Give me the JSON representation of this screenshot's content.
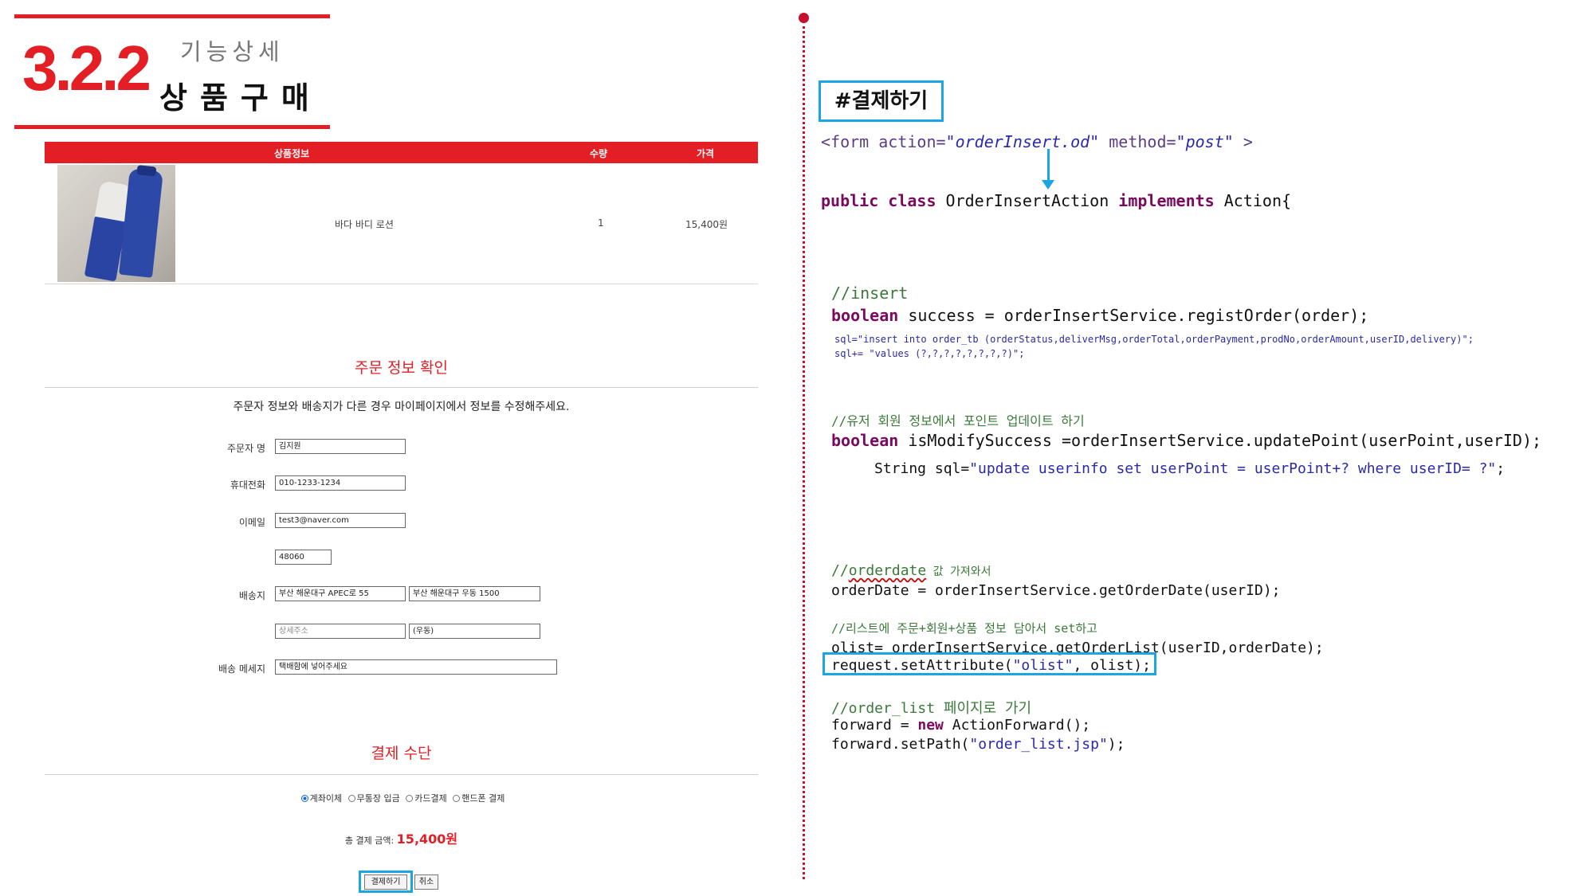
{
  "header": {
    "section_number": "3.2.2",
    "subtitle": "기능상세",
    "title": "상품구매"
  },
  "cart": {
    "columns": [
      "상품정보",
      "수량",
      "가격"
    ],
    "item": {
      "name": "바다 바디 로션",
      "qty": "1",
      "price": "15,400원"
    }
  },
  "order_info": {
    "heading": "주문 정보 확인",
    "notice": "주문자 정보와 배송지가 다른 경우 마이페이지에서 정보를 수정해주세요.",
    "labels": {
      "name": "주문자 명",
      "phone": "휴대전화",
      "email": "이메일",
      "address": "배송지",
      "message": "배송 메세지"
    },
    "values": {
      "name": "김지원",
      "phone": "010-1233-1234",
      "email": "test3@naver.com",
      "zip": "48060",
      "address1": "부산 해운대구 APEC로 55",
      "address2": "부산 해운대구 우동 1500",
      "address_detail_placeholder": "상세주소",
      "dong": "(우동)",
      "message": "택배함에 넣어주세요"
    }
  },
  "payment": {
    "heading": "결제 수단",
    "options": [
      "계좌이체",
      "무통장 입금",
      "카드결제",
      "핸드폰 결제"
    ],
    "selected_index": 0,
    "total_label": "총 결제 금액:",
    "total_amount": "15,400원",
    "pay_button": "결제하기",
    "cancel_button": "취소"
  },
  "code_panel": {
    "title": "#결제하기",
    "form_line": {
      "open": "<form action=",
      "action": "\"orderInsert.od\"",
      "method_attr": " method=",
      "method": "\"post\"",
      "close": " >"
    },
    "class_line": {
      "kw1": "public class",
      "name": " OrderInsertAction ",
      "kw2": "implements",
      "rest": " Action{"
    },
    "insert_comment": "//insert",
    "insert_line": {
      "kw": "boolean",
      "rest": " success = orderInsertService.registOrder(order);"
    },
    "sql_line1": "sql=\"insert into order_tb (orderStatus,deliverMsg,orderTotal,orderPayment,prodNo,orderAmount,userID,delivery)\";",
    "sql_line2": "sql+= \"values (?,?,?,?,?,?,?,?)\";",
    "point_comment": "//유저 회원 정보에서 포인트 업데이트 하기",
    "point_line": {
      "kw": "boolean",
      "rest": " isModifySuccess =orderInsertService.updatePoint(userPoint,userID);"
    },
    "point_sql": {
      "prefix": "String sql=",
      "value": "\"update userinfo set userPoint = userPoint+? where userID= ?\"",
      "suffix": ";"
    },
    "date_comment": {
      "prefix": "//",
      "word": "orderdate",
      "suffix": " 값 가져와서"
    },
    "date_line": "orderDate = orderInsertService.getOrderDate(userID);",
    "list_comment": "//리스트에 주문+회원+상품 정보 담아서 set하고",
    "list_line": "olist= orderInsertService.getOrderList(userID,orderDate);",
    "attr_line": {
      "prefix": "request.setAttribute(",
      "key": "\"olist\"",
      "suffix": ", olist);"
    },
    "forward_comment": "//order_list 페이지로 가기",
    "forward_line1": {
      "prefix": "forward = ",
      "kw": "new",
      "suffix": " ActionForward();"
    },
    "forward_line2": {
      "prefix": "forward.setPath(",
      "value": "\"order_list.jsp\"",
      "suffix": ");"
    }
  },
  "colors": {
    "accent_red": "#e31e24",
    "highlight_blue": "#1ba6e3",
    "keyword_purple": "#7b0a5e"
  }
}
